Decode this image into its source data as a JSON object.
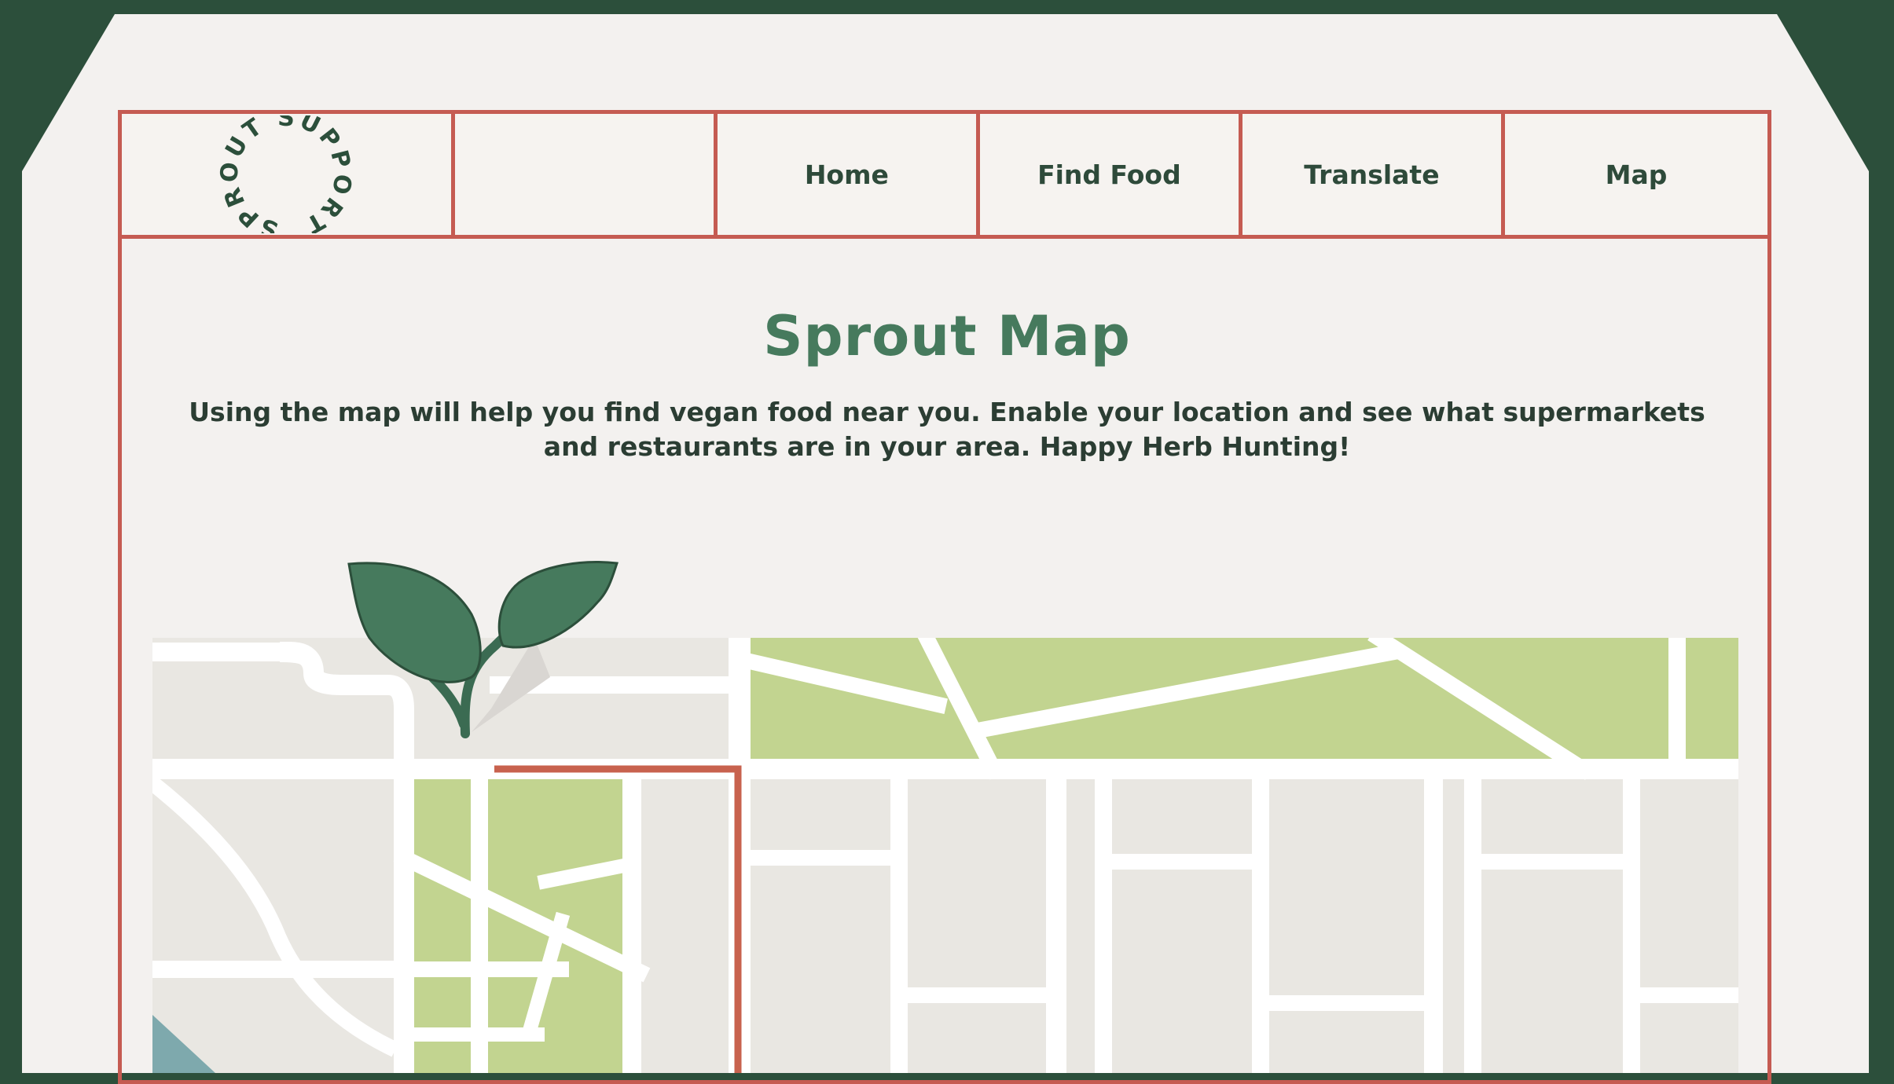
{
  "logo": {
    "text": "SPROUT SUPPORT",
    "icon": "sprout-support-logo"
  },
  "nav": {
    "items": [
      {
        "label": "Home"
      },
      {
        "label": "Find Food"
      },
      {
        "label": "Translate"
      },
      {
        "label": "Map"
      }
    ]
  },
  "page": {
    "title": "Sprout Map",
    "intro": "Using the map will help you find vegan food near you. Enable your location and see what supermarkets and restaurants are in your area. Happy Herb Hunting!"
  },
  "map": {
    "icon": "street-map",
    "marker_icon": "sprout-leaf-pin-icon"
  },
  "colors": {
    "background": "#2c4f3b",
    "card": "#f3f1ef",
    "border": "#c55b52",
    "title": "#467a5d",
    "park": "#c2d490",
    "route": "#c8624e"
  }
}
